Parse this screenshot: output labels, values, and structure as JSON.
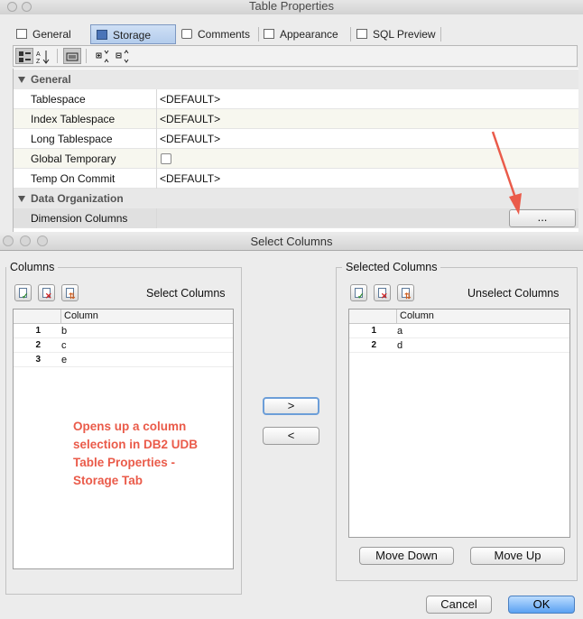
{
  "table_properties": {
    "title": "Table Properties",
    "tabs": [
      {
        "label": "General",
        "selected": false
      },
      {
        "label": "Storage",
        "selected": true
      },
      {
        "label": "Comments",
        "selected": false
      },
      {
        "label": "Appearance",
        "selected": false
      },
      {
        "label": "SQL Preview",
        "selected": false
      }
    ],
    "sections": {
      "general": "General",
      "data_org": "Data Organization"
    },
    "properties": [
      {
        "key": "Tablespace",
        "value": "<DEFAULT>"
      },
      {
        "key": "Index Tablespace",
        "value": "<DEFAULT>"
      },
      {
        "key": "Long Tablespace",
        "value": "<DEFAULT>"
      },
      {
        "key": "Global Temporary",
        "value": ""
      },
      {
        "key": "Temp On Commit",
        "value": "<DEFAULT>"
      }
    ],
    "dimension_columns": {
      "key": "Dimension Columns",
      "button": "..."
    }
  },
  "select_columns": {
    "title": "Select Columns",
    "columns_group": {
      "label": "Columns",
      "action": "Select Columns",
      "header": "Column",
      "rows": [
        {
          "n": "1",
          "v": "b"
        },
        {
          "n": "2",
          "v": "c"
        },
        {
          "n": "3",
          "v": "e"
        }
      ]
    },
    "selected_group": {
      "label": "Selected Columns",
      "action": "Unselect Columns",
      "header": "Column",
      "rows": [
        {
          "n": "1",
          "v": "a"
        },
        {
          "n": "2",
          "v": "d"
        }
      ]
    },
    "add_button": ">",
    "remove_button": "<",
    "move_down": "Move Down",
    "move_up": "Move Up",
    "cancel": "Cancel",
    "ok": "OK"
  },
  "annotation": "Opens up a column selection in DB2 UDB Table Properties - Storage Tab",
  "colors": {
    "annotation": "#ea5b4a",
    "selected_tab": "#b3ccec",
    "ok_button": "#5aa1f2"
  }
}
